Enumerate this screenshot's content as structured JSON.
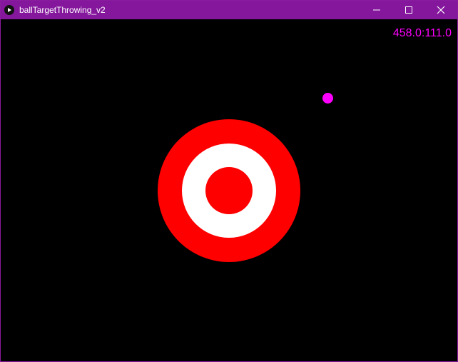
{
  "window": {
    "title": "ballTargetThrowing_v2",
    "accent": "#84179c"
  },
  "titlebar_buttons": {
    "minimize": "minimize-icon",
    "maximize": "maximize-icon",
    "close": "close-icon"
  },
  "game": {
    "background": "#000000",
    "readout": "458.0:111.0",
    "readout_color": "#ff00ff",
    "target": {
      "outer_color": "#ff0000",
      "middle_color": "#ffffff",
      "bullseye_color": "#ff0000"
    },
    "ball_color": "#ff00ff"
  }
}
